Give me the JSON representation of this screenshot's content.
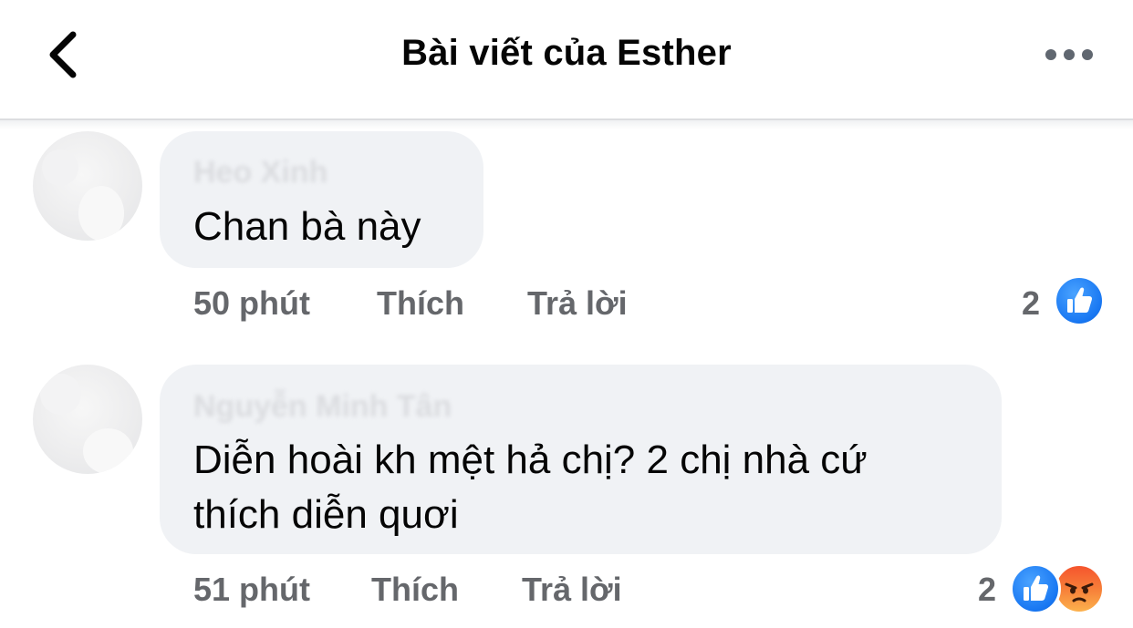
{
  "header": {
    "title": "Bài viết của Esther",
    "back_icon": "chevron-left-icon",
    "more_icon": "more-dots-icon"
  },
  "comments": [
    {
      "author": "Heo Xinh",
      "text_lines": [
        "Chan bà này"
      ],
      "time": "50 phút",
      "like_label": "Thích",
      "reply_label": "Trả lời",
      "reaction_count": "2",
      "reactions": [
        "like-icon"
      ]
    },
    {
      "author": "Nguyễn Minh Tân",
      "text_lines": [
        "Diễn hoài kh mệt hả chị? 2 chị nhà cứ",
        "thích diễn quơi"
      ],
      "time": "51 phút",
      "like_label": "Thích",
      "reply_label": "Trả lời",
      "reaction_count": "2",
      "reactions": [
        "like-icon",
        "angry-icon"
      ]
    }
  ],
  "colors": {
    "like_blue": "#1877f2",
    "angry_orange": "#f5542d",
    "bubble_bg": "#f0f2f5",
    "meta_gray": "#65676b"
  }
}
